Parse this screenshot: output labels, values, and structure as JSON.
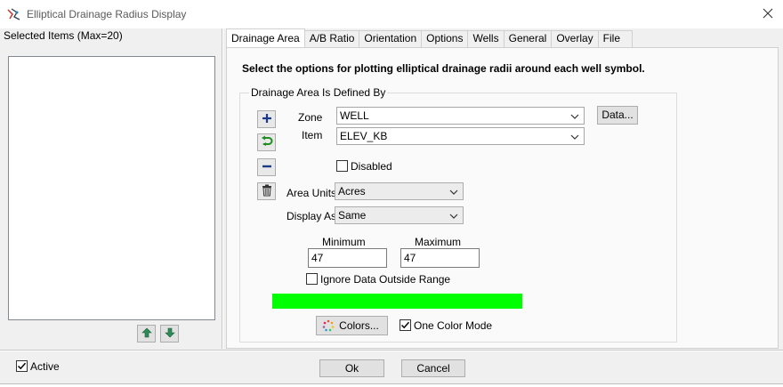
{
  "window": {
    "title": "Elliptical Drainage Radius Display",
    "app_icon": "edr-app-icon",
    "close_icon": "close-icon"
  },
  "left": {
    "selected_label": "Selected Items (Max=20)",
    "up_icon": "arrow-up-icon",
    "down_icon": "arrow-down-icon"
  },
  "tabs": [
    {
      "label": "Drainage Area",
      "active": true
    },
    {
      "label": "A/B Ratio"
    },
    {
      "label": "Orientation"
    },
    {
      "label": "Options"
    },
    {
      "label": "Wells"
    },
    {
      "label": "General"
    },
    {
      "label": "Overlay"
    },
    {
      "label": "File"
    }
  ],
  "panel": {
    "heading": "Select the options for plotting elliptical drainage radii around each well symbol.",
    "group_label": "Drainage Area Is Defined By",
    "zone_label": "Zone",
    "zone_value": "WELL",
    "item_label": "Item",
    "item_value": "ELEV_KB",
    "data_button": "Data...",
    "disabled_label": "Disabled",
    "disabled_checked": false,
    "area_units_label": "Area Units",
    "area_units_value": "Acres",
    "display_as_label": "Display As",
    "display_as_value": "Same",
    "minimum_label": "Minimum",
    "minimum_value": "47",
    "maximum_label": "Maximum",
    "maximum_value": "47",
    "ignore_label": "Ignore Data Outside Range",
    "ignore_checked": false,
    "color_bar": "#00ff00",
    "colors_button": "Colors...",
    "one_color_label": "One Color Mode",
    "one_color_checked": true
  },
  "footer": {
    "active_label": "Active",
    "active_checked": true,
    "ok_label": "Ok",
    "cancel_label": "Cancel"
  }
}
